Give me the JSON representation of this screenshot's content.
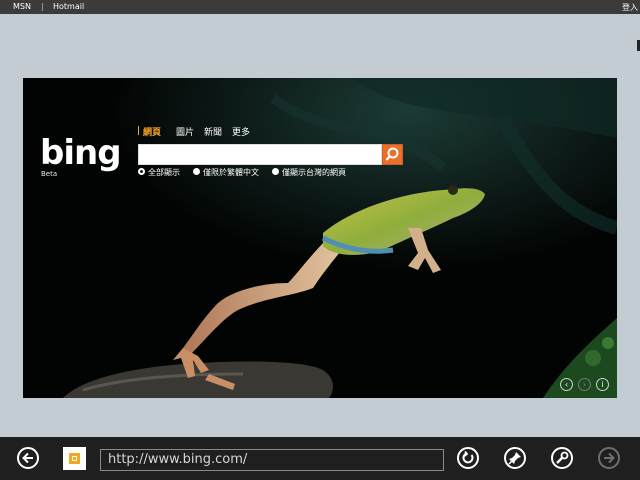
{
  "topbar": {
    "links": [
      "MSN",
      "Hotmail"
    ],
    "separator": "|",
    "right_label": "登入"
  },
  "bing": {
    "logo_text": "bing",
    "beta_label": "Beta",
    "nav": [
      "網頁",
      "圖片",
      "新聞",
      "更多"
    ],
    "active_nav": "網頁",
    "search": {
      "value": "",
      "placeholder": ""
    },
    "radio_options": [
      "全部顯示",
      "僅限於繁體中文",
      "僅顯示台灣的網頁"
    ],
    "selected_radio": "全部顯示",
    "controls": {
      "prev": "‹",
      "next": "›",
      "info": "i"
    }
  },
  "bottombar": {
    "url": "http://www.bing.com/",
    "icons": [
      "back-icon",
      "refresh-icon",
      "pin-icon",
      "tools-icon",
      "forward-icon"
    ]
  },
  "colors": {
    "accent": "#f7a325",
    "search_button": "#e8702a",
    "page_bg": "#c3ccd2",
    "bar_bg": "#1f1f1f"
  }
}
